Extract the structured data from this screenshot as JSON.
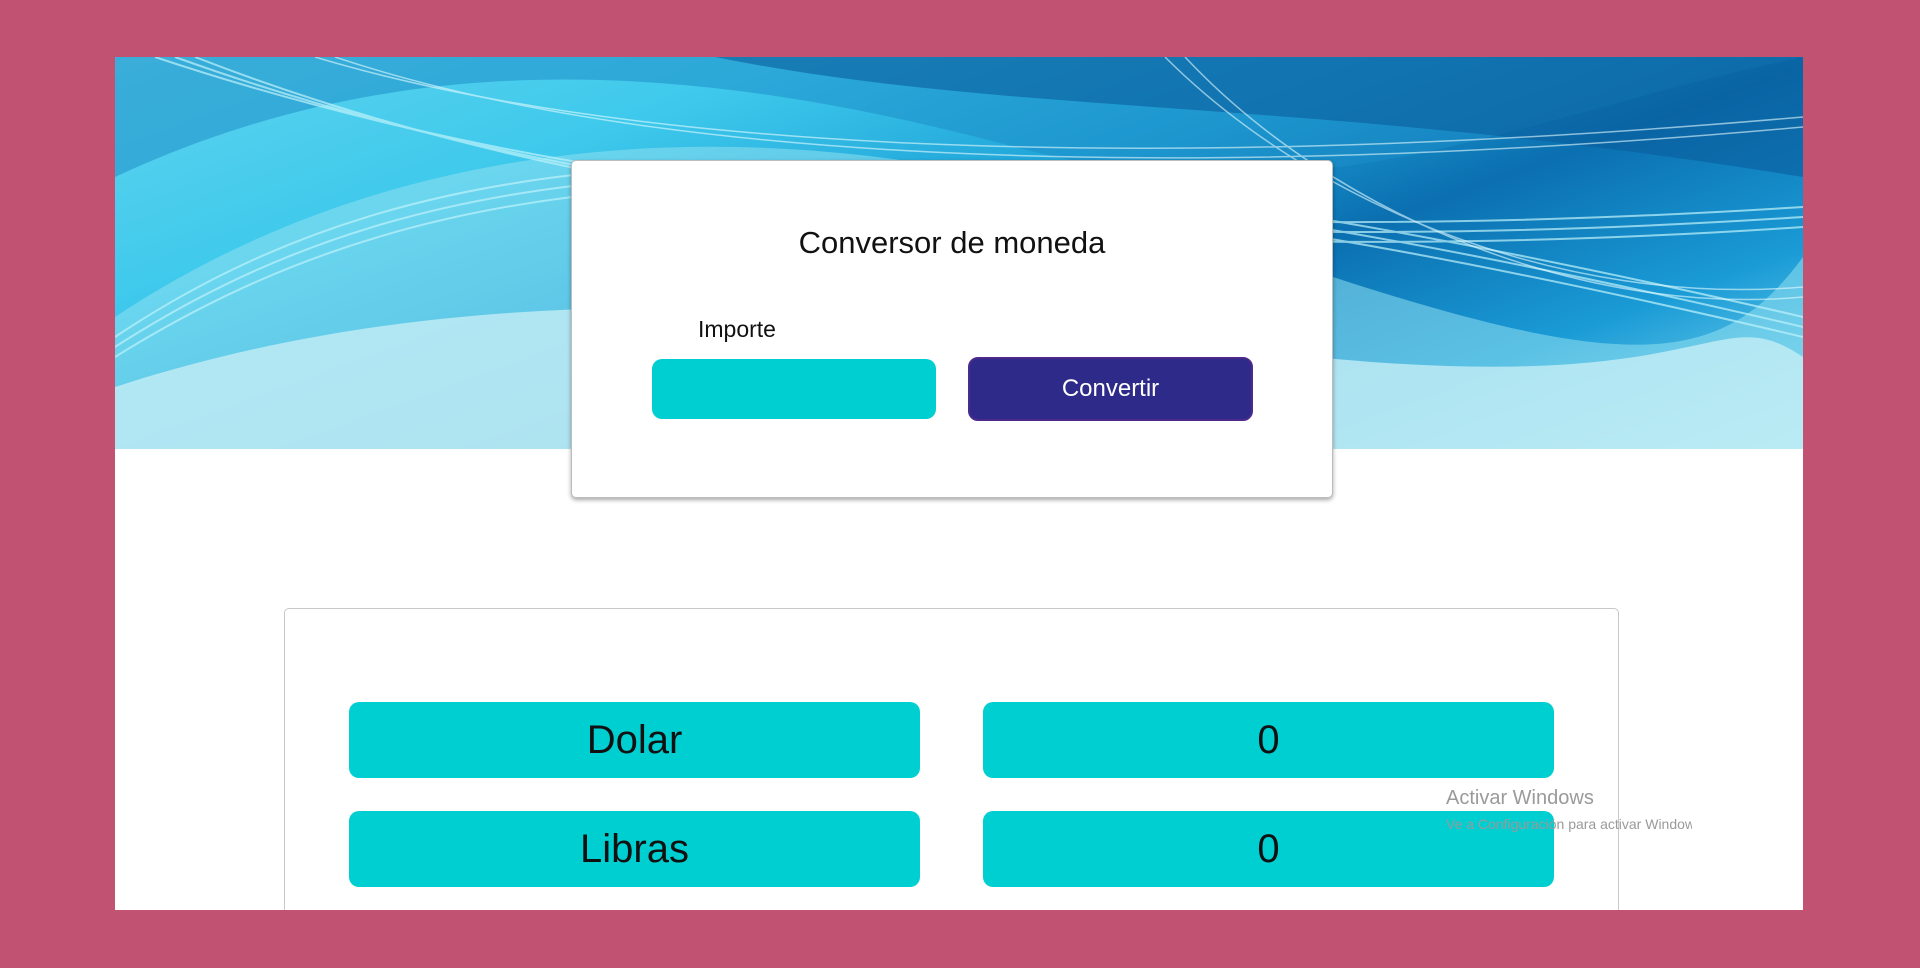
{
  "card": {
    "title": "Conversor de moneda",
    "amount_label": "Importe",
    "amount_value": "",
    "convert_button": "Convertir"
  },
  "results": [
    {
      "currency": "Dolar",
      "value": "0"
    },
    {
      "currency": "Libras",
      "value": "0"
    }
  ],
  "watermark": {
    "line1": "Activar Windows",
    "line2": "Ve a Configuración para activar Windows."
  },
  "colors": {
    "page_background": "#c25272",
    "accent_teal": "#00cfd1",
    "button_indigo": "#2d2a89"
  }
}
